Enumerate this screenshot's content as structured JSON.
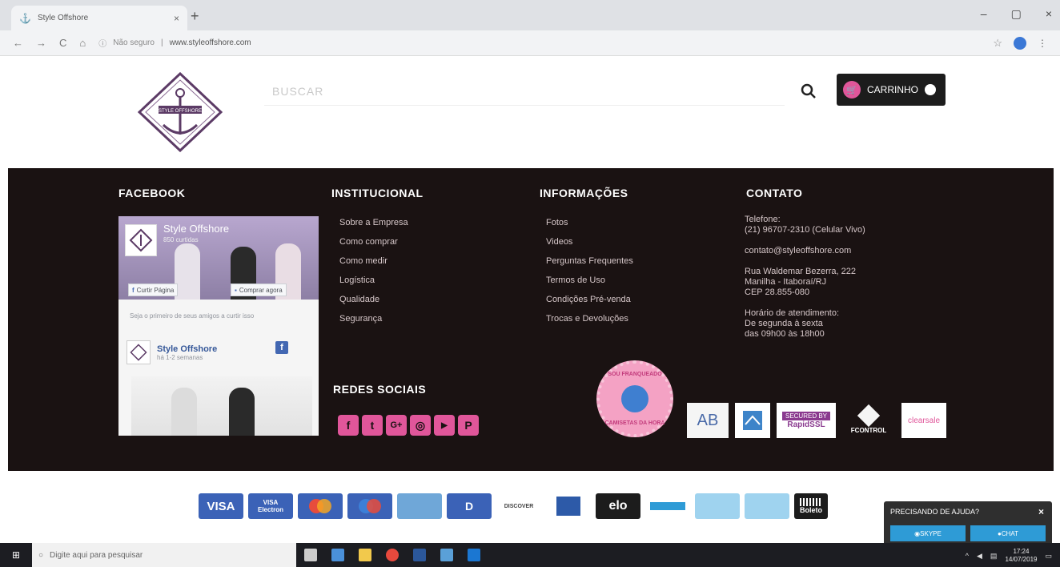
{
  "browser": {
    "tab_title": "Style Offshore",
    "address_security": "Não seguro",
    "address_url": "www.styleoffshore.com"
  },
  "header": {
    "search_placeholder": "BUSCAR",
    "cart_label": "CARRINHO",
    "cart_count": ""
  },
  "footer": {
    "facebook": {
      "title": "FACEBOOK",
      "page_name": "Style Offshore",
      "page_likes": "850 curtidas",
      "like_button": "Curtir Página",
      "share_button": "Comprar agora",
      "friends_text": "Seja o primeiro de seus amigos a curtir isso",
      "post_name": "Style Offshore",
      "post_sub": "há 1-2 semanas"
    },
    "institucional": {
      "title": "INSTITUCIONAL",
      "links": [
        "Sobre a Empresa",
        "Como comprar",
        "Como medir",
        "Logística",
        "Qualidade",
        "Segurança"
      ]
    },
    "informacoes": {
      "title": "INFORMAÇÕES",
      "links": [
        "Fotos",
        "Videos",
        "Perguntas Frequentes",
        "Termos de Uso",
        "Condições Pré-venda",
        "Trocas e Devoluções"
      ]
    },
    "contato": {
      "title": "CONTATO",
      "phone_label": "Telefone:",
      "phone": "(21) 96707-2310 (Celular Vivo)",
      "email": "contato@styleoffshore.com",
      "address_1": "Rua Waldemar Bezerra, 222",
      "address_2": "Manilha - Itaboraí/RJ",
      "address_3": "CEP 28.855-080",
      "hours_label": "Horário de atendimento:",
      "hours_1": "De segunda à sexta",
      "hours_2": "das 09h00 às 18h00"
    },
    "redes_sociais": {
      "title": "REDES SOCIAIS"
    },
    "seal": {
      "top": "SOU FRANQUEADO",
      "bottom": "CAMISETAS DA HORA"
    },
    "badges": {
      "ab": "AB",
      "rapidssl_1": "SECURED BY",
      "rapidssl_2": "RapidSSL",
      "fcontrol": "FCONTROL",
      "clearsale": "clearsale"
    }
  },
  "payments": {
    "visa": "VISA",
    "visa_electron_1": "VISA",
    "visa_electron_2": "Electron",
    "diners": "D",
    "discover": "DISCOVER",
    "elo": "elo",
    "boleto": "Boleto"
  },
  "help": {
    "title": "PRECISANDO DE AJUDA?",
    "close": "×",
    "skype": "SKYPE",
    "chat": "CHAT"
  },
  "taskbar": {
    "search_placeholder": "Digite aqui para pesquisar",
    "time": "17:24",
    "date": "14/07/2019"
  },
  "colors": {
    "accent_pink": "#e0569a",
    "footer_bg": "#1a1212",
    "cart_bg": "#1c1c1c"
  }
}
